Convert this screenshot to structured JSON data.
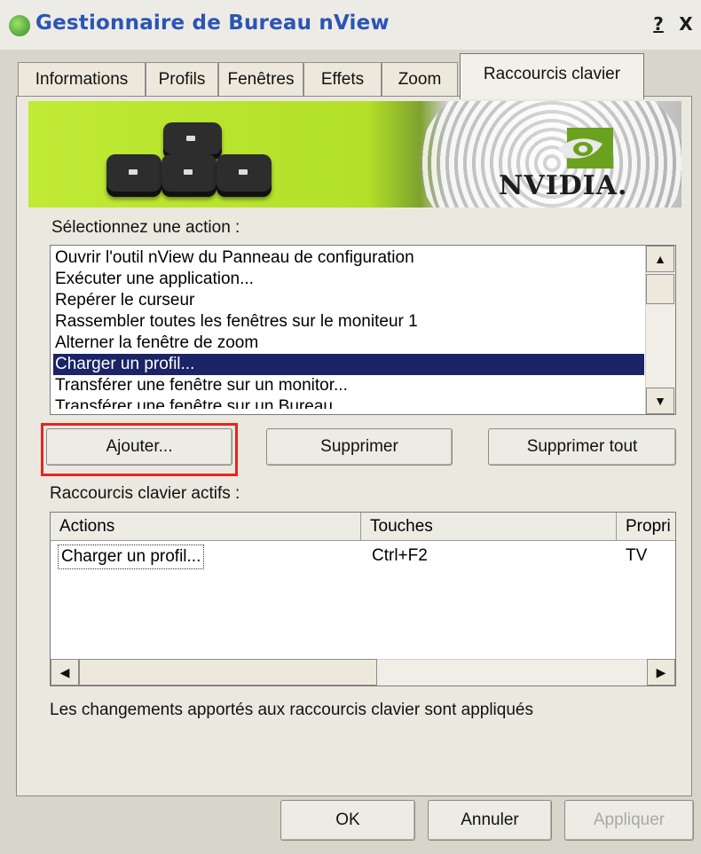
{
  "window": {
    "title": "Gestionnaire de Bureau nView",
    "help_label": "?",
    "close_label": "X"
  },
  "tabs": [
    {
      "label": "Informations"
    },
    {
      "label": "Profils"
    },
    {
      "label": "Fenêtres"
    },
    {
      "label": "Effets"
    },
    {
      "label": "Zoom"
    },
    {
      "label": "Raccourcis clavier"
    }
  ],
  "active_tab": "Raccourcis clavier",
  "banner": {
    "logo_text": "NVIDIA."
  },
  "actions": {
    "label": "Sélectionnez une action :",
    "items": [
      {
        "label": "Ouvrir l'outil nView du Panneau de configuration"
      },
      {
        "label": "Exécuter une application..."
      },
      {
        "label": "Repérer le curseur"
      },
      {
        "label": "Rassembler toutes les fenêtres sur le moniteur 1"
      },
      {
        "label": "Alterner la fenêtre de zoom"
      },
      {
        "label": "Charger un profil..."
      },
      {
        "label": "Transférer une fenêtre sur un monitor..."
      },
      {
        "label": "Transférer une fenêtre sur un Bureau..."
      }
    ],
    "selected_index": 5
  },
  "buttons": {
    "add": "Ajouter...",
    "remove": "Supprimer",
    "remove_all": "Supprimer tout"
  },
  "hotkeys": {
    "label": "Raccourcis clavier actifs :",
    "columns": [
      "Actions",
      "Touches",
      "Propri"
    ],
    "rows": [
      {
        "action": "Charger un profil...",
        "keys": "Ctrl+F2",
        "prop": "TV"
      }
    ]
  },
  "note": "Les changements apportés aux raccourcis clavier sont appliqués",
  "footer": {
    "ok": "OK",
    "cancel": "Annuler",
    "apply": "Appliquer"
  },
  "colors": {
    "selection": "#1a2466",
    "title_text": "#2b54b4",
    "highlight_border": "#e3261f"
  }
}
